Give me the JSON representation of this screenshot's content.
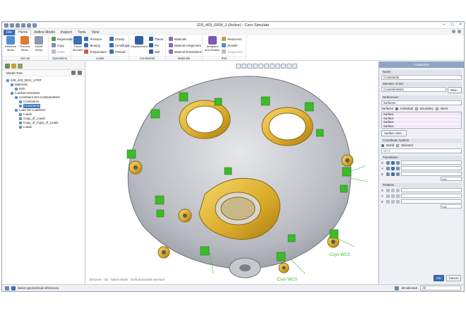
{
  "window": {
    "title": "229_403_0004_1 (Active) - Creo Simulate"
  },
  "tabs": [
    "File",
    "Home",
    "Refine Model",
    "Inspect",
    "Tools",
    "View"
  ],
  "ribbon": {
    "setup": {
      "label": "Set Up",
      "buttons": [
        "Structure Mode",
        "Thermal Mode",
        "Model Setup"
      ]
    },
    "operations": {
      "label": "Operations",
      "items": [
        "Regenerate",
        "Copy",
        "Paste"
      ]
    },
    "loads": {
      "label": "Loads",
      "force": "Force/ Moment",
      "items": [
        "Pressure",
        "Bearing",
        "Temperature",
        "Gravity",
        "Centrifugal",
        "Preload"
      ]
    },
    "constraints": {
      "label": "Constraints",
      "displacement": "Displacement",
      "items": [
        "Planar",
        "Pin",
        "Ball"
      ]
    },
    "materials": {
      "label": "Materials",
      "items": [
        "Materials",
        "Material Assignment",
        "Material Orientations"
      ]
    },
    "run": {
      "label": "Run",
      "analyses": "Analyses and Studies",
      "items": [
        "Resources",
        "Results",
        "Diagnostics"
      ]
    }
  },
  "tree": {
    "header": "Model Tree",
    "items": [
      {
        "label": "229_403_0004_1.PRT",
        "level": 0
      },
      {
        "label": "Materials",
        "level": 1
      },
      {
        "label": "R25",
        "level": 2
      },
      {
        "label": "Loads/Constraints",
        "level": 1
      },
      {
        "label": "Constraint Set ConstraintSet1",
        "level": 2
      },
      {
        "label": "Constraint1",
        "level": 3
      },
      {
        "label": "Constraint2",
        "level": 3,
        "selected": true
      },
      {
        "label": "Load Set LoadSet1",
        "level": 2
      },
      {
        "label": "Load1",
        "level": 3
      },
      {
        "label": "Copy_of_Load1",
        "level": 3
      },
      {
        "label": "Copy_of_Copy_of_Load1",
        "level": 3
      },
      {
        "label": "Loads",
        "level": 3
      }
    ]
  },
  "viewport": {
    "status": "Structure : 3D : Native Mode : Default Bonded Interface",
    "wcs_labels": [
      "Csys WCS",
      "Csys WCS"
    ]
  },
  "dialog": {
    "title": "Constraint",
    "name_label": "Name",
    "name_value": "Constraint2",
    "member_label": "Member of Set",
    "member_value": "ConstraintSet1",
    "new_button": "New...",
    "refs_label": "References",
    "refs_value": "Surfaces",
    "refs_mode_label": "Surfaces",
    "refs_modes": [
      "Individual",
      "Boundary",
      "Intent"
    ],
    "surfaces": [
      "Surface",
      "Surface",
      "Surface",
      "Surface"
    ],
    "surface_sets_button": "Surface Sets...",
    "csys_label": "Coordinate System",
    "csys_modes": [
      "World",
      "Selected"
    ],
    "csys_value": "WCS",
    "translation_label": "Translation",
    "axes": [
      "X",
      "Y",
      "Z"
    ],
    "na": "N/A",
    "rotation_label": "Rotation",
    "ok": "OK",
    "cancel": "Cancel"
  },
  "statusbar": {
    "message": "Select geometrical references.",
    "selected": "26 selected",
    "filter": "All"
  }
}
